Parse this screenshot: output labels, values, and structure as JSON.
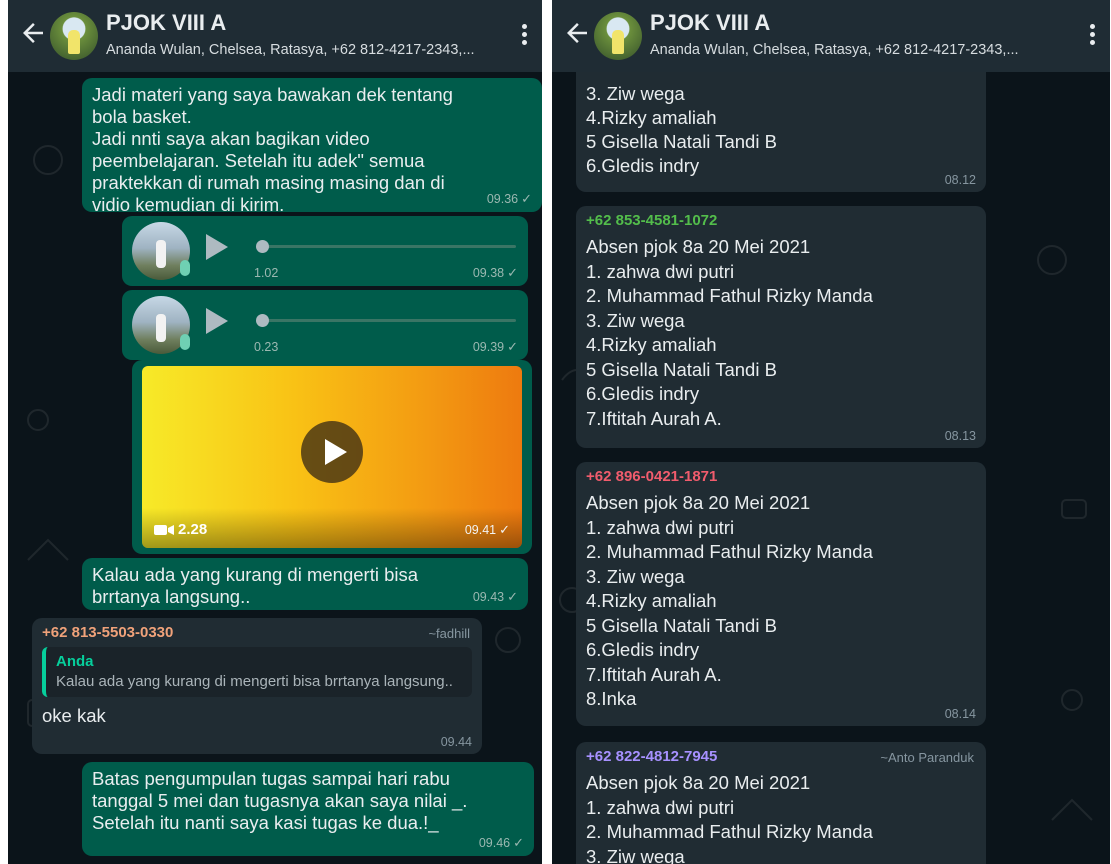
{
  "colors": {
    "chat_bg": "#0b141a",
    "header_bg": "#1f2c34",
    "outgoing_bubble": "#005c4b",
    "incoming_bubble": "#202c33",
    "accent_green": "#06cf9c",
    "sender_orange": "#f0a27a",
    "sender_green": "#53bd4b",
    "sender_red": "#f15c6d",
    "sender_purple": "#a791ff"
  },
  "header": {
    "back_icon": "arrow-left-icon",
    "title": "PJOK VIII A",
    "subtitle": "Ananda Wulan, Chelsea, Ratasya, +62 812-4217-2343,...",
    "menu_icon": "more-vertical-icon"
  },
  "left": {
    "msg1": {
      "text": "Jadi materi yang saya bawakan dek tentang\nbola basket.\nJadi nnti saya akan bagikan video\npeembelajaran. Setelah itu adek\" semua\npraktekkan di rumah masing masing dan di\nvidio kemudian di kirim.",
      "time": "09.36"
    },
    "voice1": {
      "duration": "1.02",
      "time": "09.38"
    },
    "voice2": {
      "duration": "0.23",
      "time": "09.39"
    },
    "video": {
      "duration": "2.28",
      "time": "09.41",
      "icon": "video-camera-icon"
    },
    "msg2": {
      "text": "Kalau ada yang kurang di mengerti bisa\nbrrtanya langsung..",
      "time": "09.43"
    },
    "reply": {
      "sender": "+62 813-5503-0330",
      "alias": "~fadhill",
      "quoted_name": "Anda",
      "quoted_text": "Kalau ada yang kurang di mengerti bisa brrtanya langsung..",
      "text": "oke kak",
      "time": "09.44"
    },
    "msg3": {
      "text": "Batas pengumpulan tugas sampai hari rabu\ntanggal 5 mei dan tugasnya akan saya nilai _.\nSetelah itu nanti saya kasi tugas ke dua.!_",
      "time": "09.46"
    },
    "tick": "✓"
  },
  "right": {
    "msg1": {
      "text": "3. Ziw wega\n4.Rizky amaliah\n5 Gisella Natali Tandi B\n6.Gledis indry",
      "time": "08.12"
    },
    "msg2": {
      "sender": "+62 853-4581-1072",
      "text": "Absen pjok 8a 20 Mei 2021\n1. zahwa dwi putri\n2. Muhammad Fathul Rizky Manda\n3. Ziw wega\n4.Rizky amaliah\n5 Gisella Natali Tandi B\n6.Gledis indry\n7.Iftitah Aurah A.",
      "time": "08.13"
    },
    "msg3": {
      "sender": "+62 896-0421-1871",
      "text": "Absen pjok 8a 20 Mei 2021\n1. zahwa dwi putri\n2. Muhammad Fathul Rizky Manda\n3. Ziw wega\n4.Rizky amaliah\n5 Gisella Natali Tandi B\n6.Gledis indry\n7.Iftitah Aurah A.\n8.Inka",
      "time": "08.14"
    },
    "msg4": {
      "sender": "+62 822-4812-7945",
      "alias": "~Anto Paranduk",
      "text": "Absen pjok 8a 20 Mei 2021\n1. zahwa dwi putri\n2. Muhammad Fathul Rizky Manda\n3. Ziw wega"
    }
  }
}
